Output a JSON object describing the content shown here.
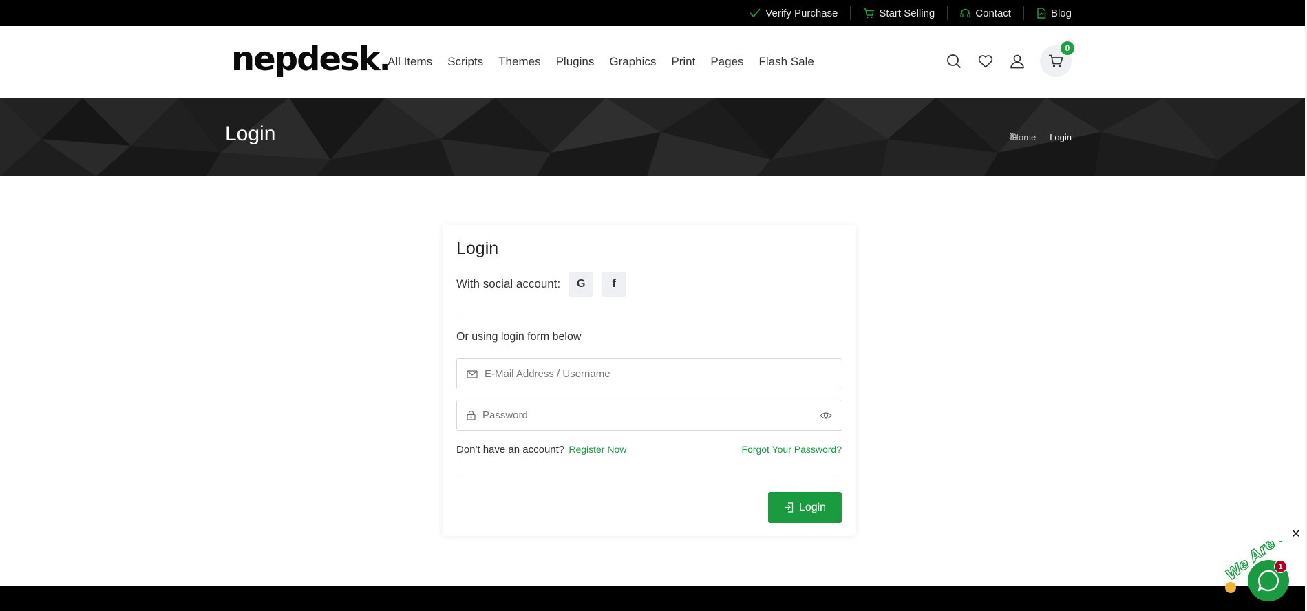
{
  "topbar": {
    "links": [
      {
        "label": "Verify Purchase",
        "icon": "check-icon"
      },
      {
        "label": "Start Selling",
        "icon": "cart-icon"
      },
      {
        "label": "Contact",
        "icon": "headset-icon"
      },
      {
        "label": "Blog",
        "icon": "document-icon"
      }
    ]
  },
  "header": {
    "logo": "nepdesk.",
    "nav": [
      "All Items",
      "Scripts",
      "Themes",
      "Plugins",
      "Graphics",
      "Print",
      "Pages",
      "Flash Sale"
    ],
    "cart_count": "0"
  },
  "banner": {
    "title": "Login",
    "breadcrumb_home": "Home",
    "breadcrumb_current": "Login"
  },
  "login_card": {
    "title": "Login",
    "social_label": "With social account:",
    "google_label": "G",
    "facebook_label": "f",
    "or_text": "Or using login form below",
    "email_placeholder": "E-Mail Address / Username",
    "password_placeholder": "Password",
    "no_account_text": "Don't have an account?",
    "register_label": "Register Now",
    "forgot_label": "Forgot Your Password?",
    "login_button": "Login"
  },
  "chat": {
    "badge_count": "1",
    "close_label": "✕",
    "tagline": "We Are Here!"
  },
  "colors": {
    "accent": "#1a9b40",
    "topbar": "#000000",
    "banner": "#1b1b1b"
  }
}
